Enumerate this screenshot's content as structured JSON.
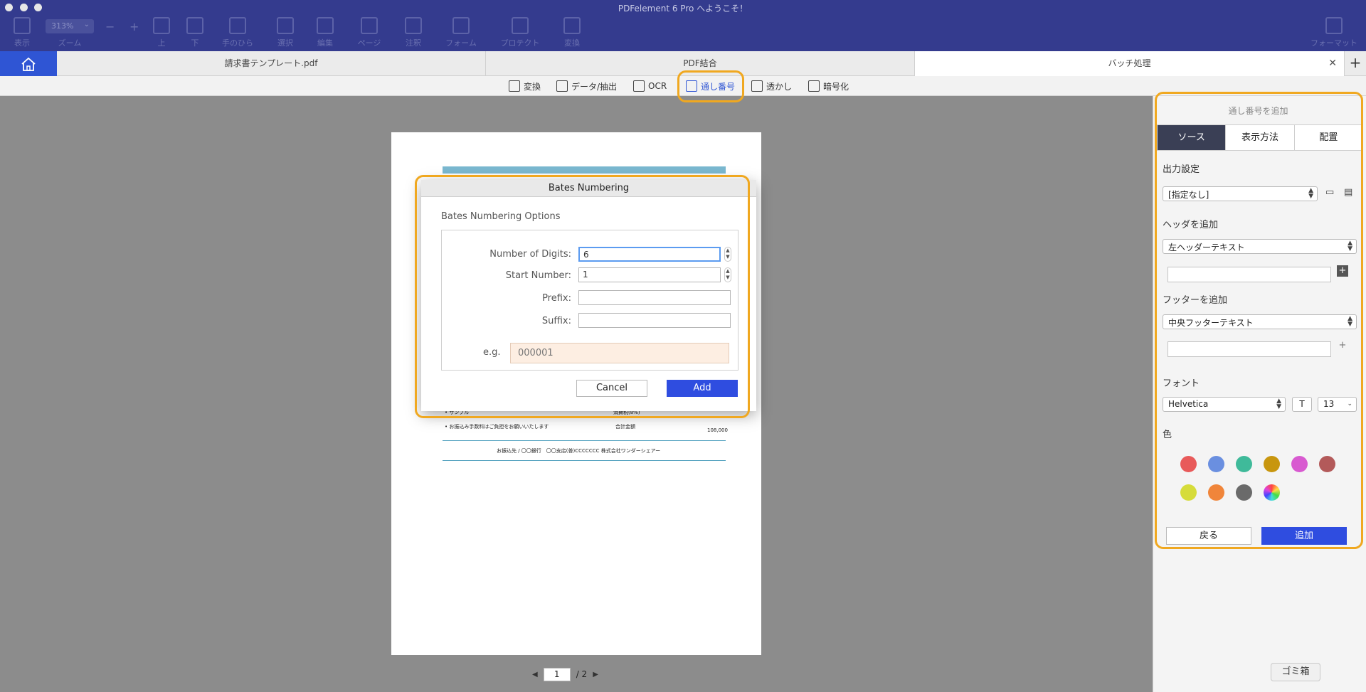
{
  "window": {
    "title": "PDFelement 6 Pro へようこそ！"
  },
  "toolbar": {
    "view_label": "表示",
    "zoom_value": "313%",
    "zoom_label": "ズーム",
    "minus": "−",
    "plus": "+",
    "up_label": "上",
    "down_label": "下",
    "hand_label": "手のひら",
    "select_label": "選択",
    "edit_label": "編集",
    "page_label": "ページ",
    "comment_label": "注釈",
    "form_label": "フォーム",
    "protect_label": "プロテクト",
    "convert_label": "変換",
    "format_label": "フォーマット"
  },
  "tabs": {
    "tab1": "請求書テンプレート.pdf",
    "tab2": "PDF結合",
    "tab3": "バッチ処理",
    "close": "✕",
    "add": "+"
  },
  "subtoolbar": {
    "convert": "変換",
    "data_extract": "データ/抽出",
    "ocr": "OCR",
    "bates": "通し番号",
    "watermark": "透かし",
    "encrypt": "暗号化"
  },
  "document": {
    "row1_left": "• サンプル",
    "row1_mid": "消費税(8%)",
    "row2_left": "• お振込み手数料はご負担をお願いいたします",
    "row2_mid": "合計金額",
    "row2_right": "108,000",
    "footer": "お振込先 / 〇〇銀行　〇〇支店(普)CCCCCCC 株式会社ワンダーシェアー"
  },
  "pager": {
    "current": "1",
    "total": "/ 2",
    "prev": "◀",
    "next": "▶"
  },
  "dialog": {
    "title": "Bates Numbering",
    "options_title": "Bates Numbering Options",
    "digits_label": "Number of Digits:",
    "digits_value": "6",
    "start_label": "Start Number:",
    "start_value": "1",
    "prefix_label": "Prefix:",
    "prefix_value": "",
    "suffix_label": "Suffix:",
    "suffix_value": "",
    "example_label": "e.g.",
    "example_value": "000001",
    "cancel": "Cancel",
    "add": "Add"
  },
  "panel": {
    "title": "通し番号を追加",
    "tabs": [
      "ソース",
      "表示方法",
      "配置"
    ],
    "output_label": "出力設定",
    "output_value": "[指定なし]",
    "header_label": "ヘッダを追加",
    "header_value": "左ヘッダーテキスト",
    "footer_label": "フッターを追加",
    "footer_value": "中央フッターテキスト",
    "font_label": "フォント",
    "font_value": "Helvetica",
    "font_style": "T",
    "font_size": "13",
    "color_label": "色",
    "back": "戻る",
    "add": "追加"
  },
  "colors": {
    "swatches": [
      "#e85a5a",
      "#6a8fe0",
      "#3fba9a",
      "#c8960e",
      "#d85ad0",
      "#b35a5a",
      "#d6dc3a",
      "#f0853a",
      "#6a6a6a"
    ],
    "accent": "#2f4de0",
    "highlight": "#f0a820"
  },
  "trash": "ゴミ箱"
}
